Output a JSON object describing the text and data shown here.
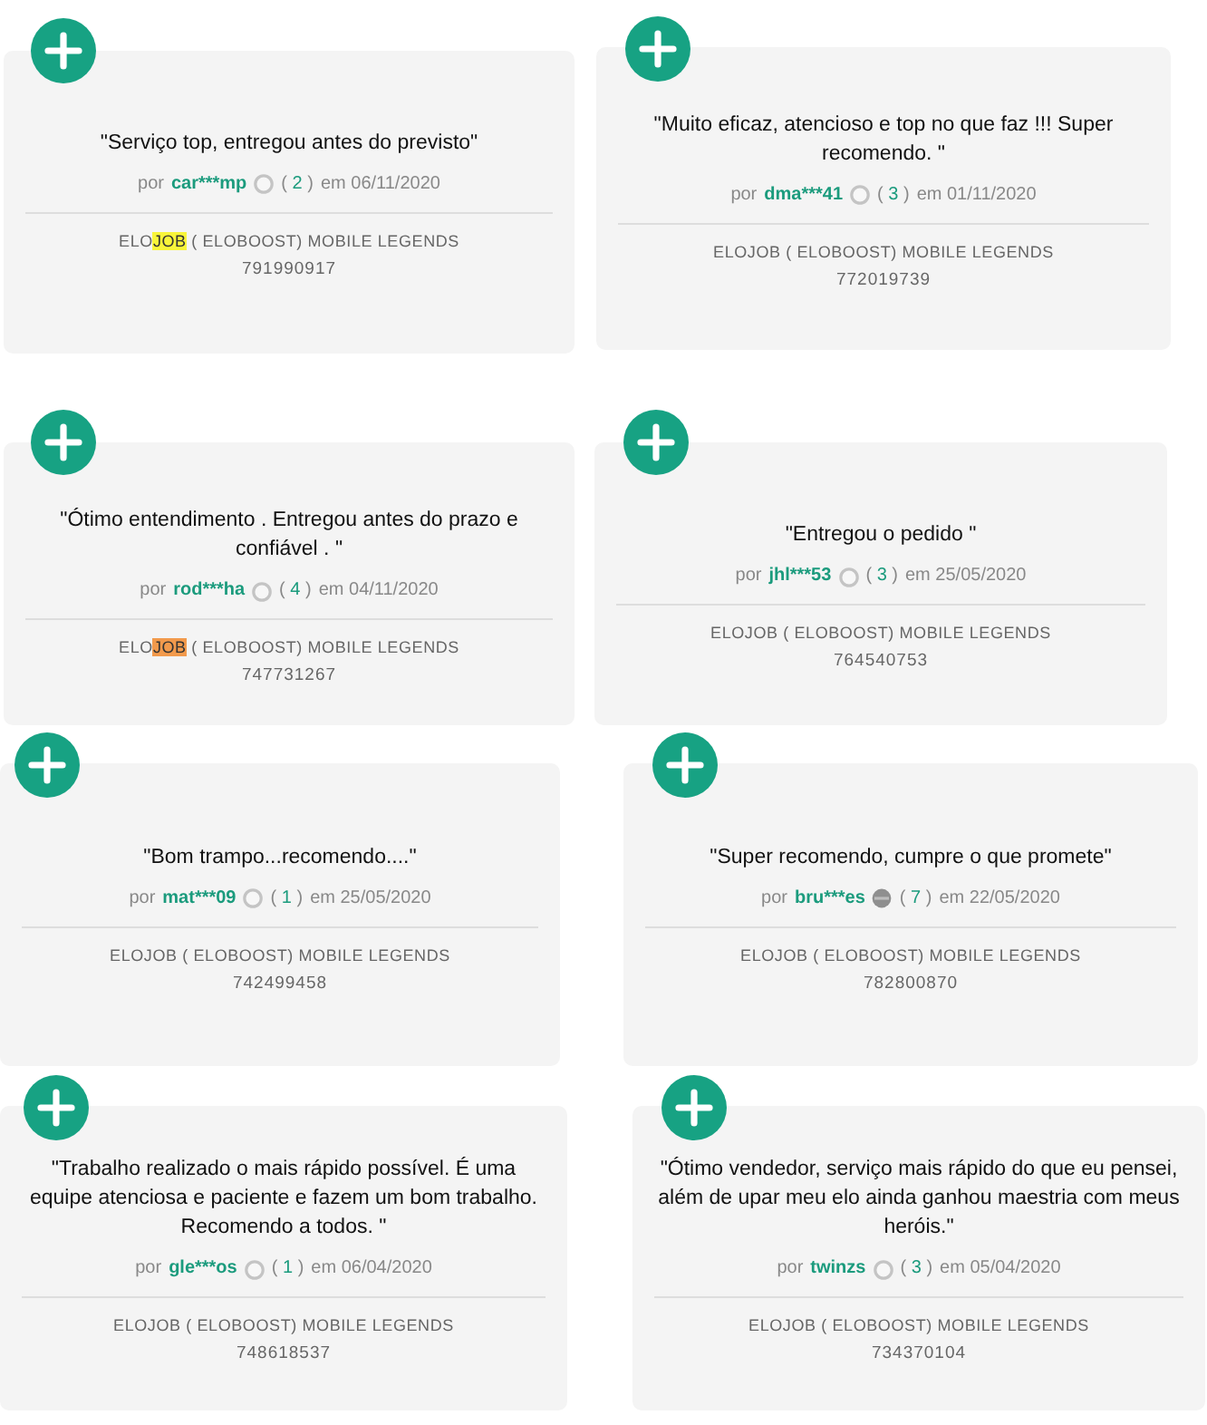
{
  "reviews": [
    {
      "quote": "\"Serviço top, entregou antes do previsto\"",
      "author_prefix": "por",
      "username": "car***mp",
      "rank_badge_filled": false,
      "count": {
        "open": "(",
        "value": "2",
        "close": ")"
      },
      "date": "em 06/11/2020",
      "product": [
        {
          "text": "ELO",
          "highlighted": false
        },
        {
          "text": "JOB",
          "highlighted": true,
          "current_match": false
        },
        {
          "text": " ( ELOBOOST) MOBILE LEGENDS",
          "highlighted": false
        }
      ],
      "order_number": "791990917"
    },
    {
      "quote": "\"Muito eficaz, atencioso e top no que faz !!! Super recomendo. \"",
      "author_prefix": "por",
      "username": "dma***41",
      "rank_badge_filled": false,
      "count": {
        "open": "(",
        "value": "3",
        "close": ")"
      },
      "date": "em 01/11/2020",
      "product": [
        {
          "text": "ELOJOB ( ELOBOOST) MOBILE LEGENDS",
          "highlighted": false
        }
      ],
      "order_number": "772019739"
    },
    {
      "quote": "\"Ótimo entendimento . Entregou antes do prazo e confiável . \"",
      "author_prefix": "por",
      "username": "rod***ha",
      "rank_badge_filled": false,
      "count": {
        "open": "(",
        "value": "4",
        "close": ")"
      },
      "date": "em 04/11/2020",
      "product": [
        {
          "text": "ELO",
          "highlighted": false
        },
        {
          "text": "JOB",
          "highlighted": true,
          "current_match": true
        },
        {
          "text": " ( ELOBOOST) MOBILE LEGENDS",
          "highlighted": false
        }
      ],
      "order_number": "747731267"
    },
    {
      "quote": "\"Entregou o pedido \"",
      "author_prefix": "por",
      "username": "jhl***53",
      "rank_badge_filled": false,
      "count": {
        "open": "(",
        "value": "3",
        "close": ")"
      },
      "date": "em 25/05/2020",
      "product": [
        {
          "text": "ELOJOB ( ELOBOOST) MOBILE LEGENDS",
          "highlighted": false
        }
      ],
      "order_number": "764540753"
    },
    {
      "quote": "\"Bom trampo...recomendo....\"",
      "author_prefix": "por",
      "username": "mat***09",
      "rank_badge_filled": false,
      "count": {
        "open": "(",
        "value": "1",
        "close": ")"
      },
      "date": "em 25/05/2020",
      "product": [
        {
          "text": "ELOJOB ( ELOBOOST) MOBILE LEGENDS",
          "highlighted": false
        }
      ],
      "order_number": "742499458"
    },
    {
      "quote": "\"Super recomendo, cumpre o que promete\"",
      "author_prefix": "por",
      "username": "bru***es",
      "rank_badge_filled": true,
      "count": {
        "open": "(",
        "value": "7",
        "close": ")"
      },
      "date": "em 22/05/2020",
      "product": [
        {
          "text": "ELOJOB ( ELOBOOST) MOBILE LEGENDS",
          "highlighted": false
        }
      ],
      "order_number": "782800870"
    },
    {
      "quote": "\"Trabalho realizado o mais rápido possível. É uma equipe atenciosa e paciente e fazem um bom trabalho. Recomendo a todos. \"",
      "author_prefix": "por",
      "username": "gle***os",
      "rank_badge_filled": false,
      "count": {
        "open": "(",
        "value": "1",
        "close": ")"
      },
      "date": "em 06/04/2020",
      "product": [
        {
          "text": "ELOJOB ( ELOBOOST) MOBILE LEGENDS",
          "highlighted": false
        }
      ],
      "order_number": "748618537"
    },
    {
      "quote": "\"Ótimo vendedor, serviço mais rápido do que eu pensei, além de upar meu elo ainda ganhou maestria com meus heróis.\"",
      "author_prefix": "por",
      "username": "twinzs",
      "rank_badge_filled": false,
      "count": {
        "open": "(",
        "value": "3",
        "close": ")"
      },
      "date": "em 05/04/2020",
      "product": [
        {
          "text": "ELOJOB ( ELOBOOST) MOBILE LEGENDS",
          "highlighted": false
        }
      ],
      "order_number": "734370104"
    }
  ]
}
